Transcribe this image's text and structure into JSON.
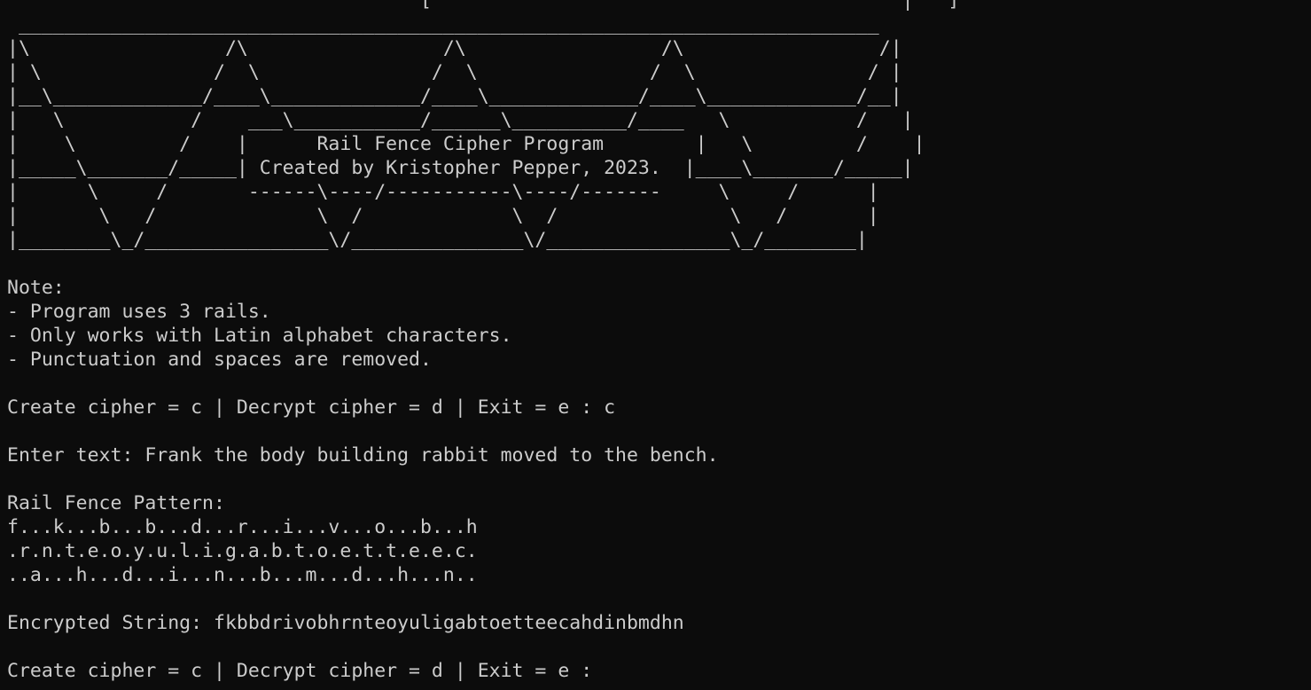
{
  "terminal": {
    "banner": [
      "                                    [                                         |   ]",
      " ___________________________________________________________________________",
      "|\\                 /\\                 /\\                 /\\                 /|",
      "| \\               /  \\               /  \\               /  \\               / |",
      "|__\\_____________/____\\_____________/____\\_____________/____\\_____________/__|",
      "|   \\           /    ___\\___________/______\\__________/____   \\           /   |",
      "|    \\         /    |      Rail Fence Cipher Program        |   \\         /    |",
      "|_____\\_______/_____| Created by Kristopher Pepper, 2023.  |____\\_______/_____|",
      "|      \\     /       ------\\----/-----------\\----/-------     \\     /      |",
      "|       \\   /              \\  /             \\  /               \\   /       |",
      "|________\\_/________________\\/_______________\\/________________\\_/________|"
    ],
    "blank_1": "",
    "note_heading": "Note:",
    "note_items": [
      "- Program uses 3 rails.",
      "- Only works with Latin alphabet characters.",
      "- Punctuation and spaces are removed."
    ],
    "blank_2": "",
    "menu_prompt_1": "Create cipher = c | Decrypt cipher = d | Exit = e : c",
    "blank_3": "",
    "enter_text_line": "Enter text: Frank the body building rabbit moved to the bench.",
    "blank_4": "",
    "pattern_heading": "Rail Fence Pattern:",
    "pattern_rows": [
      "f...k...b...b...d...r...i...v...o...b...h",
      ".r.n.t.e.o.y.u.l.i.g.a.b.t.o.e.t.t.e.e.c.",
      "..a...h...d...i...n...b...m...d...h...n.."
    ],
    "blank_5": "",
    "encrypted_line": "Encrypted String: fkbbdrivobhrnteoyuligabtoetteecahdinbmdhn",
    "blank_6": "",
    "menu_prompt_2": "Create cipher = c | Decrypt cipher = d | Exit = e : ",
    "colors": {
      "background": "#0c0c0c",
      "foreground": "#cccccc"
    }
  }
}
